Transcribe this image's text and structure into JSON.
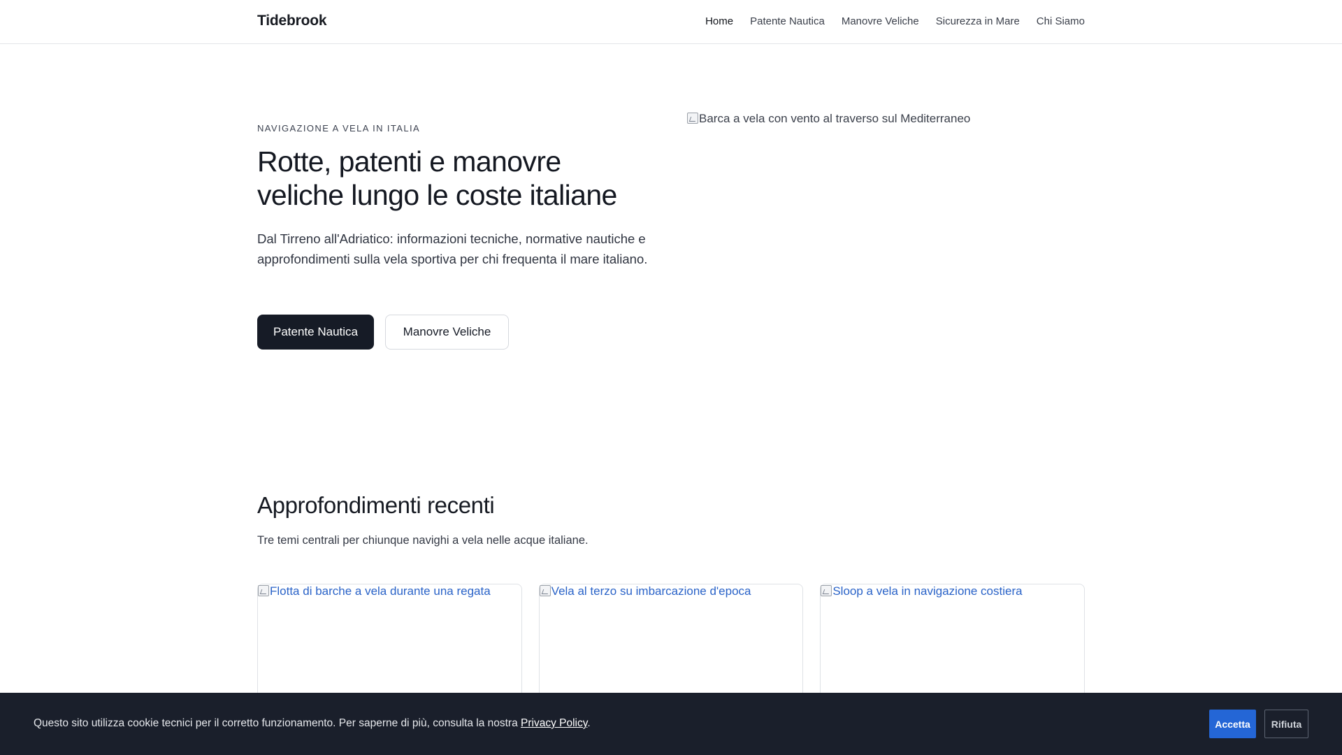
{
  "header": {
    "brand": "Tidebrook",
    "nav": [
      "Home",
      "Patente Nautica",
      "Manovre Veliche",
      "Sicurezza in Mare",
      "Chi Siamo"
    ]
  },
  "hero": {
    "eyebrow": "NAVIGAZIONE A VELA IN ITALIA",
    "title": "Rotte, patenti e manovre veliche lungo le coste italiane",
    "description": "Dal Tirreno all'Adriatico: informazioni tecniche, normative nautiche e approfondimenti sulla vela sportiva per chi frequenta il mare italiano.",
    "primary_button": "Patente Nautica",
    "secondary_button": "Manovre Veliche",
    "image_alt": "Barca a vela con vento al traverso sul Mediterraneo"
  },
  "recent": {
    "title": "Approfondimenti recenti",
    "subtitle": "Tre temi centrali per chiunque navighi a vela nelle acque italiane.",
    "cards": [
      {
        "image_alt": "Flotta di barche a vela durante una regata"
      },
      {
        "image_alt": "Vela al terzo su imbarcazione d'epoca"
      },
      {
        "image_alt": "Sloop a vela in navigazione costiera"
      }
    ]
  },
  "cookie": {
    "text": "Questo sito utilizza cookie tecnici per il corretto funzionamento. Per saperne di più, consulta la nostra ",
    "link": "Privacy Policy",
    "suffix": ".",
    "accept": "Accetta",
    "reject": "Rifiuta"
  },
  "colors": {
    "accent_dark": "#161b26",
    "cookie_bg": "#1a1f2b",
    "accept_blue": "#2466d6",
    "link_blue": "#2a63c8"
  }
}
